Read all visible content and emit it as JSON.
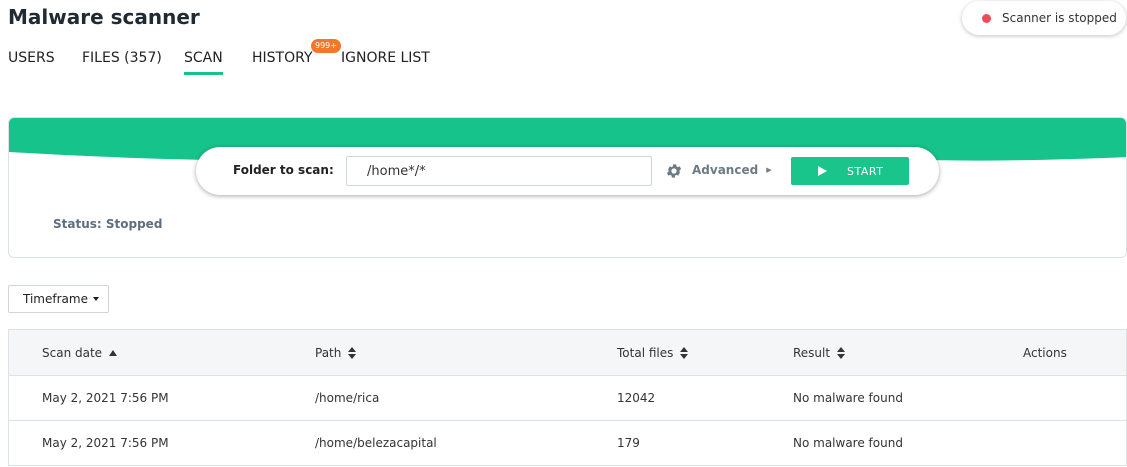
{
  "page_title": "Malware scanner",
  "scanner_status": {
    "label": "Scanner is stopped",
    "color": "#ef4a55"
  },
  "tabs": [
    {
      "label": "USERS"
    },
    {
      "label": "FILES (357)"
    },
    {
      "label": "SCAN",
      "active": true
    },
    {
      "label": "HISTORY",
      "badge": "999+"
    },
    {
      "label": "IGNORE LIST"
    }
  ],
  "scan": {
    "folder_label": "Folder to scan:",
    "folder_value": "/home*/*",
    "advanced_label": "Advanced",
    "start_label": "START",
    "status_text": "Status: Stopped",
    "accent_color": "#16c38a"
  },
  "timeframe_label": "Timeframe",
  "table": {
    "columns": [
      {
        "label": "Scan date",
        "sort": "asc"
      },
      {
        "label": "Path",
        "sort": "both"
      },
      {
        "label": "Total files",
        "sort": "both"
      },
      {
        "label": "Result",
        "sort": "both"
      },
      {
        "label": "Actions",
        "sort": "none"
      }
    ],
    "rows": [
      {
        "date": "May 2, 2021 7:56 PM",
        "path": "/home/rica",
        "total_files": "12042",
        "result": "No malware found"
      },
      {
        "date": "May 2, 2021 7:56 PM",
        "path": "/home/belezacapital",
        "total_files": "179",
        "result": "No malware found"
      }
    ]
  }
}
